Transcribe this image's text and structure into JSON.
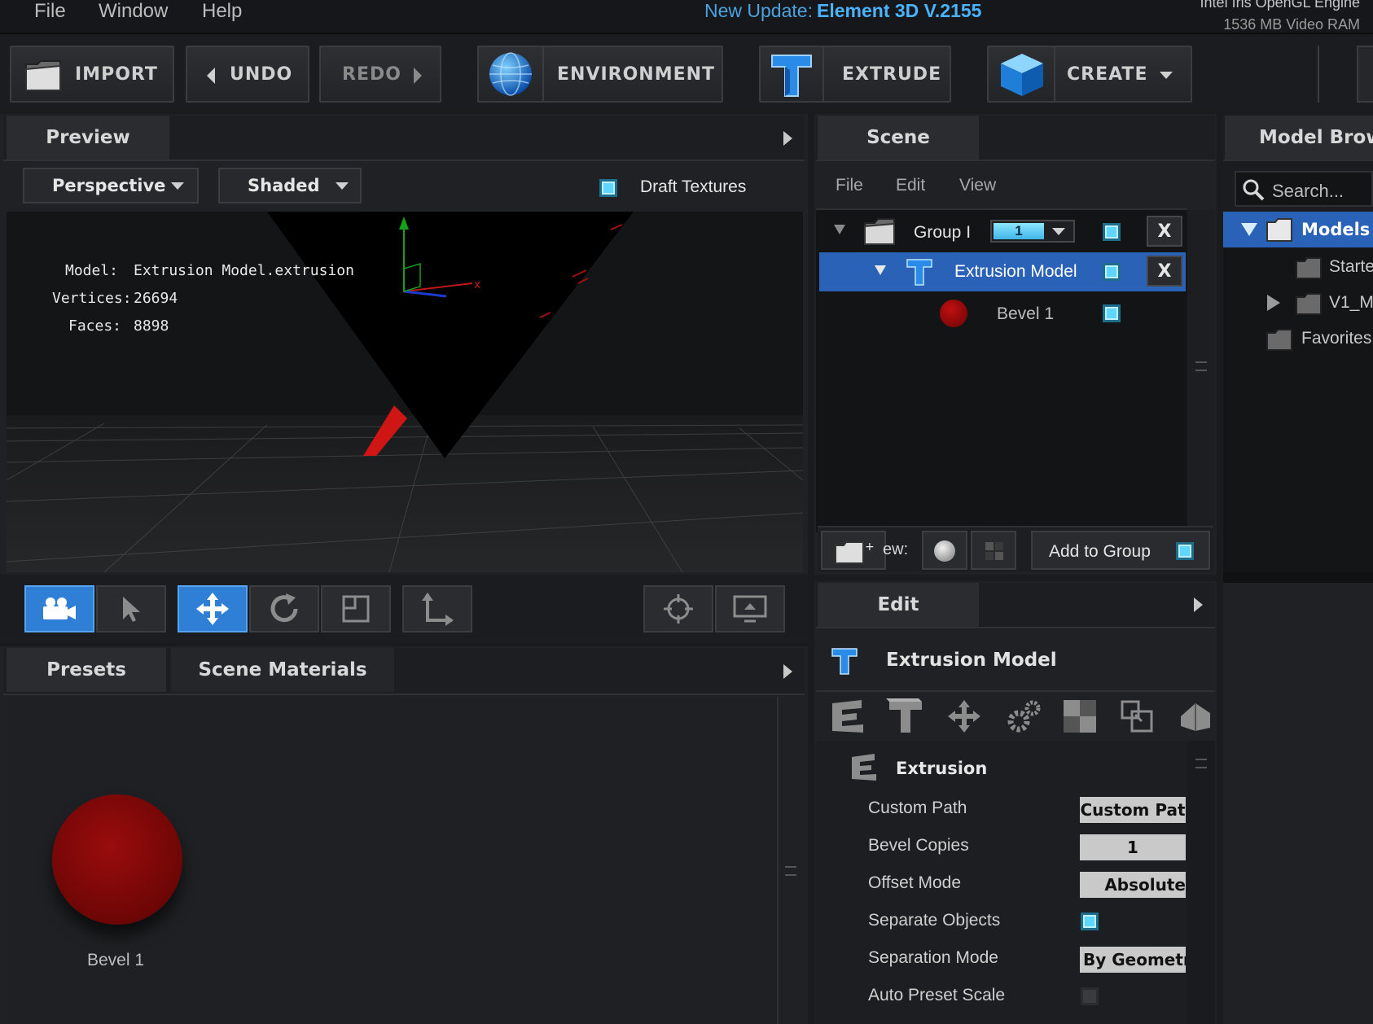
{
  "menu": {
    "items": [
      "File",
      "Window",
      "Help"
    ]
  },
  "update": {
    "label": "New Update:",
    "version": "Element 3D V.2155"
  },
  "engine": {
    "name": "Intel Iris OpenGL Engine",
    "vram": "1536 MB Video RAM"
  },
  "toolbar": {
    "import": "IMPORT",
    "undo": "UNDO",
    "redo": "REDO",
    "environment": "ENVIRONMENT",
    "extrude": "EXTRUDE",
    "create": "CREATE"
  },
  "preview": {
    "tab": "Preview",
    "view_mode": "Perspective",
    "shading": "Shaded",
    "draft_textures": "Draft Textures",
    "draft_textures_checked": true,
    "stats": {
      "model_label": "Model:",
      "model_value": "Extrusion Model.extrusion",
      "vertices_label": "Vertices:",
      "vertices_value": "26694",
      "faces_label": "Faces:",
      "faces_value": "8898"
    }
  },
  "presets": {
    "tabs": [
      "Presets",
      "Scene Materials"
    ],
    "items": [
      {
        "label": "Bevel 1",
        "color": "#8a0a0a"
      }
    ]
  },
  "scene": {
    "tab": "Scene",
    "menu": [
      "File",
      "Edit",
      "View"
    ],
    "rows": [
      {
        "label": "Group I",
        "group_number": "1"
      },
      {
        "label": "Extrusion Model",
        "selected": true
      },
      {
        "label": "Bevel 1"
      }
    ],
    "close_glyph": "X",
    "bottom_label": "ew:",
    "add_to_group": "Add to Group"
  },
  "edit": {
    "tab": "Edit",
    "title": "Extrusion Model",
    "section": "Extrusion",
    "properties": [
      {
        "label": "Custom Path",
        "value": "Custom Pat"
      },
      {
        "label": "Bevel Copies",
        "value": "1"
      },
      {
        "label": "Offset Mode",
        "value": "Absolute"
      },
      {
        "label": "Separate Objects",
        "checked": true
      },
      {
        "label": "Separation Mode",
        "value": "By Geometry"
      },
      {
        "label": "Auto Preset Scale",
        "checked": false
      }
    ]
  },
  "model_browser": {
    "tab": "Model Brow",
    "search_placeholder": "Search...",
    "tree": [
      "Models",
      "Starte",
      "V1_M",
      "Favorites"
    ]
  },
  "colors": {
    "accent": "#2f7fd6",
    "checkbox": "#5fd6ff",
    "update": "#4ab3ff",
    "bevel": "#8a0a0a"
  }
}
